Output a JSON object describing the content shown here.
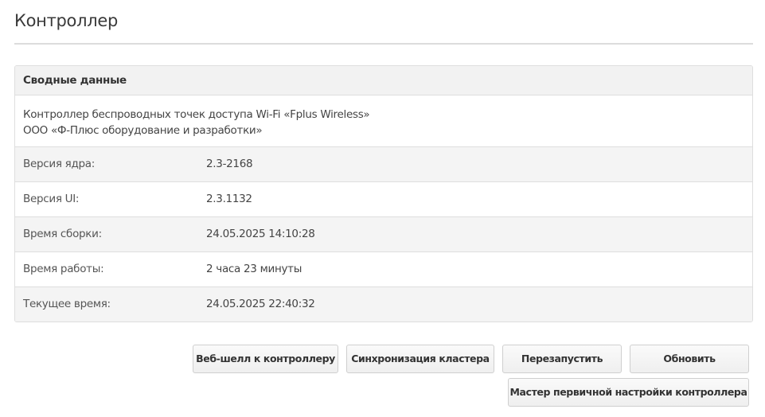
{
  "page": {
    "title": "Контроллер"
  },
  "summary": {
    "header": "Сводные данные",
    "description_line1": "Контроллер беспроводных точек доступа Wi-Fi «Fplus Wireless»",
    "description_line2": "ООО «Ф-Плюс оборудование и разработки»",
    "rows": [
      {
        "label": "Версия ядра:",
        "value": "2.3-2168"
      },
      {
        "label": "Версия UI:",
        "value": "2.3.1132"
      },
      {
        "label": "Время сборки:",
        "value": "24.05.2025 14:10:28"
      },
      {
        "label": "Время работы:",
        "value": "2 часа 23 минуты"
      },
      {
        "label": "Текущее время:",
        "value": "24.05.2025 22:40:32"
      }
    ]
  },
  "actions": {
    "web_shell": "Веб-шелл к контроллеру",
    "sync_cluster": "Синхронизация кластера",
    "restart": "Перезапустить",
    "update": "Обновить",
    "setup_wizard": "Мастер первичной настройки контроллера"
  }
}
